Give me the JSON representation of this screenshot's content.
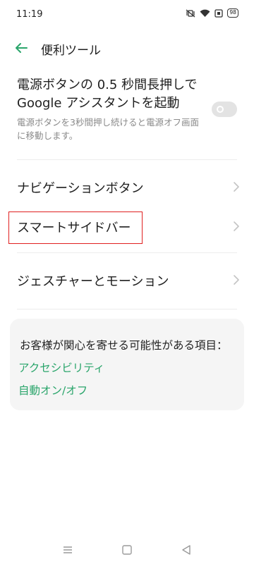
{
  "status": {
    "time": "11:19",
    "battery": "98",
    "icons": [
      "vibrate-mute-icon",
      "wifi-icon",
      "sim-icon",
      "battery-icon"
    ]
  },
  "app_bar": {
    "back_icon": "back-arrow-icon",
    "title": "便利ツール"
  },
  "power_button_setting": {
    "title": "電源ボタンの 0.5 秒間長押しで Google アシスタントを起動",
    "subtitle": "電源ボタンを3秒間押し続けると電源オフ画面に移動します。",
    "enabled": false
  },
  "menu": {
    "items": [
      {
        "label": "ナビゲーションボタン"
      },
      {
        "label": "スマートサイドバー"
      },
      {
        "label": "ジェスチャーとモーション"
      }
    ]
  },
  "suggestions": {
    "title": "お客様が関心を寄せる可能性がある項目：",
    "links": [
      "アクセシビリティ",
      "自動オン/オフ"
    ]
  },
  "nav": {
    "buttons": [
      "menu-icon",
      "home-icon",
      "back-triangle-icon"
    ]
  },
  "colors": {
    "accent": "#2aa56b",
    "highlight": "#e02020",
    "card_bg": "#f5f5f5"
  }
}
